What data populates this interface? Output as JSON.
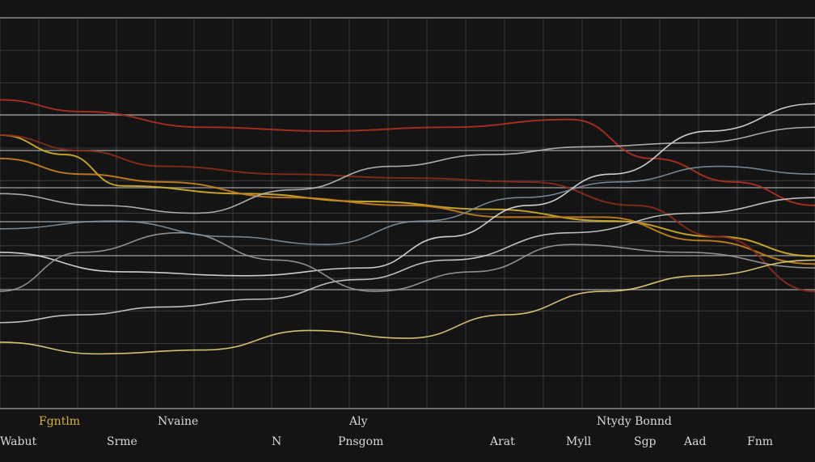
{
  "colors": {
    "background": "#141414",
    "grid": "#3a3a3a",
    "gridMajor": "#8a8a8a",
    "label": "#d8d8d8",
    "labelAccent": "#d9b23a"
  },
  "chart_data": {
    "type": "line",
    "title": "",
    "xlabel": "",
    "ylabel": "",
    "xlim": [
      0,
      100
    ],
    "ylim": [
      0,
      100
    ],
    "grid": true,
    "legend": "none",
    "labels_row1": [
      "Fgntlm",
      "Nvaine",
      "Aly",
      "Ntydy Bonnd"
    ],
    "labels_row2": [
      "Wabut",
      "Srme",
      "N",
      "Pnsgom",
      "Arat",
      "Myll",
      "Sgp",
      "Aad",
      "Fnm"
    ],
    "series": [
      {
        "color": "#d4b02a",
        "values": [
          [
            0,
            70
          ],
          [
            8,
            65
          ],
          [
            15,
            57
          ],
          [
            30,
            55
          ],
          [
            45,
            53
          ],
          [
            60,
            51
          ],
          [
            75,
            48
          ],
          [
            88,
            44
          ],
          [
            100,
            39
          ]
        ]
      },
      {
        "color": "#c9821e",
        "values": [
          [
            0,
            64
          ],
          [
            10,
            60
          ],
          [
            20,
            58
          ],
          [
            35,
            54
          ],
          [
            50,
            52
          ],
          [
            62,
            49
          ],
          [
            74,
            49
          ],
          [
            86,
            43
          ],
          [
            100,
            37
          ]
        ]
      },
      {
        "color": "#b0301e",
        "values": [
          [
            0,
            79
          ],
          [
            10,
            76
          ],
          [
            25,
            72
          ],
          [
            40,
            71
          ],
          [
            55,
            72
          ],
          [
            70,
            74
          ],
          [
            80,
            64
          ],
          [
            90,
            58
          ],
          [
            100,
            52
          ]
        ]
      },
      {
        "color": "#8a2a1a",
        "values": [
          [
            0,
            70
          ],
          [
            10,
            66
          ],
          [
            20,
            62
          ],
          [
            35,
            60
          ],
          [
            50,
            59
          ],
          [
            65,
            58
          ],
          [
            78,
            52
          ],
          [
            88,
            44
          ],
          [
            100,
            30
          ]
        ]
      },
      {
        "color": "#e0e0e0",
        "values": [
          [
            0,
            40
          ],
          [
            15,
            35
          ],
          [
            30,
            34
          ],
          [
            45,
            36
          ],
          [
            55,
            44
          ],
          [
            65,
            52
          ],
          [
            75,
            60
          ],
          [
            87,
            71
          ],
          [
            100,
            78
          ]
        ]
      },
      {
        "color": "#cfcfcf",
        "values": [
          [
            0,
            22
          ],
          [
            10,
            24
          ],
          [
            20,
            26
          ],
          [
            32,
            28
          ],
          [
            44,
            33
          ],
          [
            55,
            38
          ],
          [
            70,
            45
          ],
          [
            85,
            50
          ],
          [
            100,
            54
          ]
        ]
      },
      {
        "color": "#b8b8b8",
        "values": [
          [
            0,
            55
          ],
          [
            12,
            52
          ],
          [
            24,
            50
          ],
          [
            36,
            56
          ],
          [
            48,
            62
          ],
          [
            60,
            65
          ],
          [
            72,
            67
          ],
          [
            85,
            68
          ],
          [
            100,
            72
          ]
        ]
      },
      {
        "color": "#9a9a9a",
        "values": [
          [
            0,
            30
          ],
          [
            10,
            40
          ],
          [
            22,
            45
          ],
          [
            34,
            38
          ],
          [
            46,
            30
          ],
          [
            58,
            35
          ],
          [
            70,
            42
          ],
          [
            84,
            40
          ],
          [
            100,
            36
          ]
        ]
      },
      {
        "color": "#e8d27a",
        "values": [
          [
            0,
            17
          ],
          [
            12,
            14
          ],
          [
            25,
            15
          ],
          [
            38,
            20
          ],
          [
            50,
            18
          ],
          [
            62,
            24
          ],
          [
            74,
            30
          ],
          [
            86,
            34
          ],
          [
            100,
            38
          ]
        ]
      },
      {
        "color": "#7f8f9a",
        "values": [
          [
            0,
            46
          ],
          [
            14,
            48
          ],
          [
            28,
            44
          ],
          [
            40,
            42
          ],
          [
            52,
            48
          ],
          [
            64,
            54
          ],
          [
            76,
            58
          ],
          [
            88,
            62
          ],
          [
            100,
            60
          ]
        ]
      }
    ]
  }
}
